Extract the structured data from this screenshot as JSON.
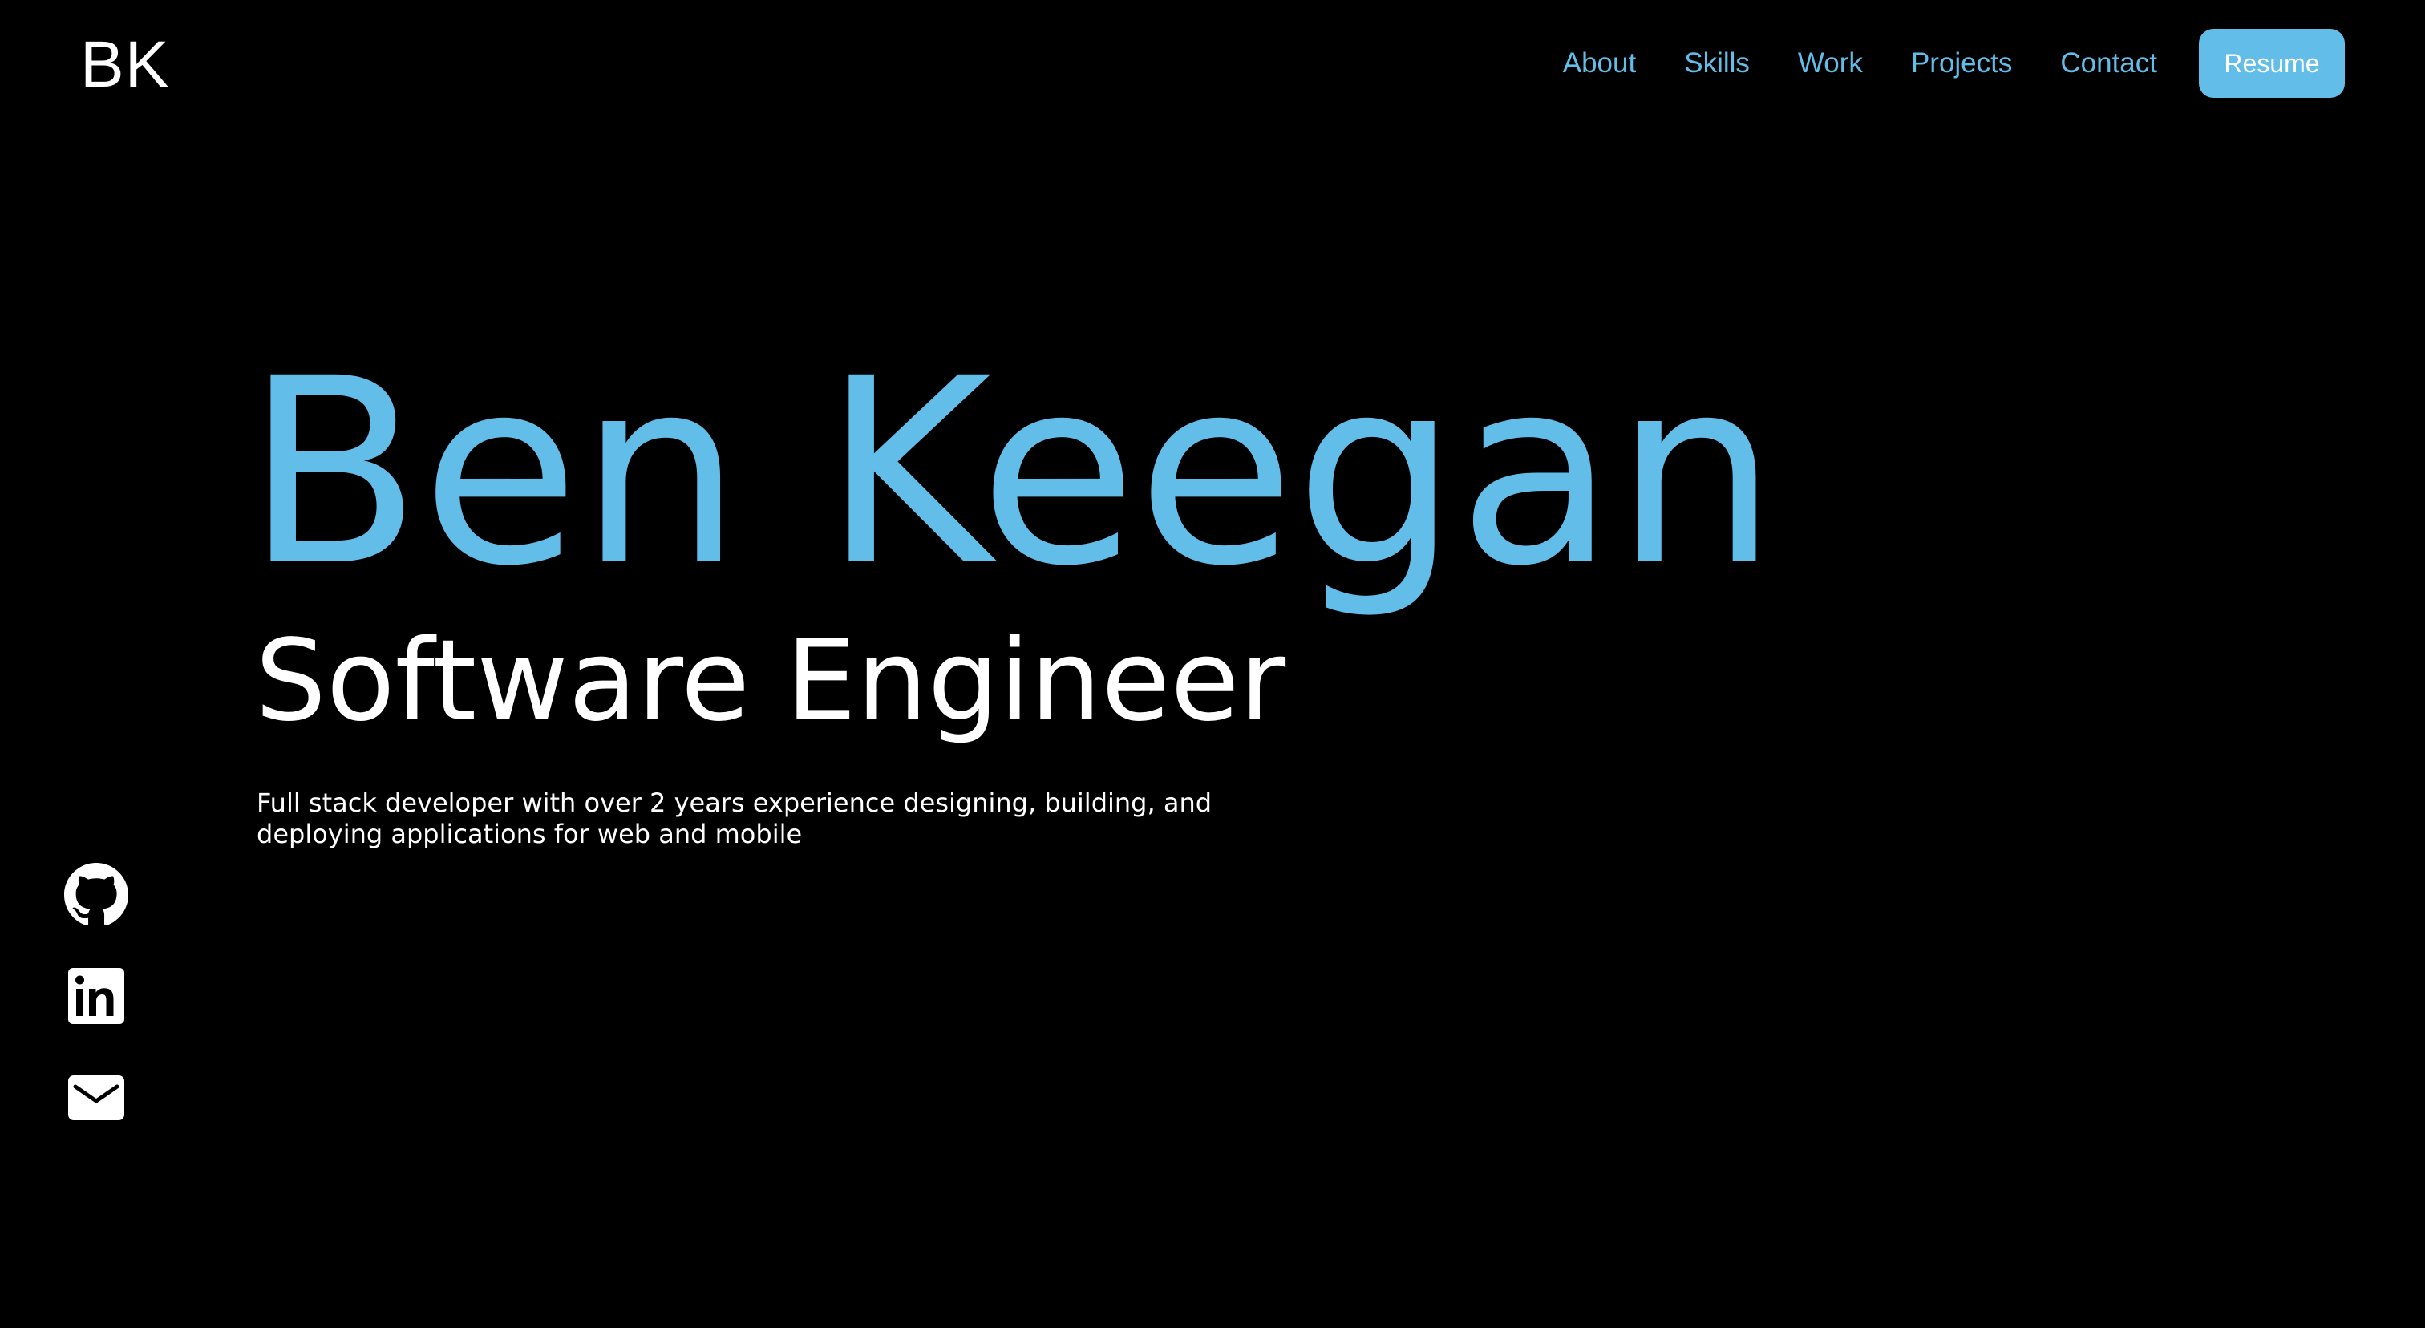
{
  "header": {
    "logo": "BK",
    "nav": {
      "about": "About",
      "skills": "Skills",
      "work": "Work",
      "projects": "Projects",
      "contact": "Contact"
    },
    "resume_label": "Resume"
  },
  "hero": {
    "name": "Ben Keegan",
    "title": "Software Engineer",
    "description": "Full stack developer with over 2 years experience designing, building, and deploying applications for web and mobile"
  },
  "social": {
    "icons": [
      "github-icon",
      "linkedin-icon",
      "email-icon"
    ]
  },
  "colors": {
    "background": "#000000",
    "accent": "#62bde9",
    "text": "#ffffff"
  }
}
